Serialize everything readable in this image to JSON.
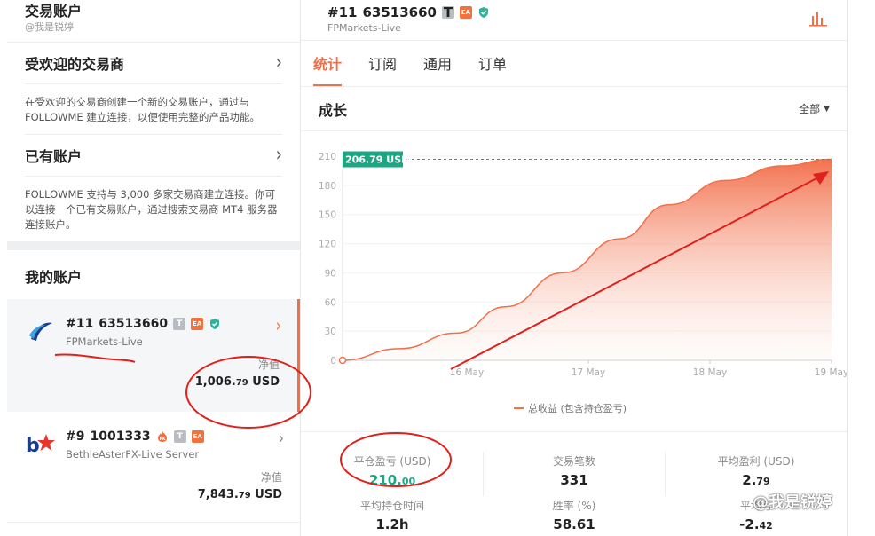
{
  "left": {
    "title": "交易账户",
    "subtitle": "@我是锐婷",
    "popular": {
      "title": "受欢迎的交易商",
      "desc": "在受欢迎的交易商创建一个新的交易账户，通过与FOLLOWME 建立连接，以便使用完整的产品功能。"
    },
    "existing": {
      "title": "已有账户",
      "desc": "FOLLOWME 支持与 3,000 多家交易商建立连接。你可以连接一个已有交易账户，通过搜索交易商 MT4 服务器连接账户。"
    },
    "my_accounts_title": "我的账户",
    "accounts": [
      {
        "num": "#11",
        "id": "63513660",
        "broker": "FPMarkets-Live",
        "nv_label": "净值",
        "nv_int": "1,006.",
        "nv_dec": "79",
        "nv_cur": "USD"
      },
      {
        "num": "#9",
        "id": "1001333",
        "broker": "BethleAsterFX-Live Server",
        "nv_label": "净值",
        "nv_int": "7,843.",
        "nv_dec": "79",
        "nv_cur": "USD"
      }
    ],
    "badge_t": "T",
    "badge_ea": "EA",
    "badge_pk": "PK"
  },
  "right": {
    "num": "#11",
    "id": "63513660",
    "broker": "FPMarkets-Live",
    "tabs": [
      "统计",
      "订阅",
      "通用",
      "订单"
    ],
    "growth_title": "成长",
    "range_label": "全部",
    "stats": [
      {
        "label": "平仓盈亏 (USD)",
        "int": "210.",
        "dec": "00"
      },
      {
        "label": "交易笔数",
        "int": "331",
        "dec": ""
      },
      {
        "label": "平均盈利 (USD)",
        "int": "2.",
        "dec": "79"
      },
      {
        "label": "平均持仓时间",
        "int": "1.2h",
        "dec": ""
      },
      {
        "label": "胜率 (%)",
        "int": "58.61",
        "dec": ""
      },
      {
        "label": "平均亏",
        "int": "-2.",
        "dec": "42"
      }
    ]
  },
  "chart_data": {
    "type": "area",
    "x": [
      "16 May",
      "17 May",
      "18 May",
      "19 May"
    ],
    "series": [
      {
        "name": "总收益 (包含持仓盈亏)",
        "x": [
          0,
          0.35,
          0.7,
          1,
          1.35,
          1.7,
          2,
          2.35,
          2.7,
          3
        ],
        "values": [
          0,
          12,
          28,
          55,
          90,
          125,
          160,
          185,
          200,
          206.79
        ]
      }
    ],
    "ylim": [
      0,
      210
    ],
    "yticks": [
      0,
      30,
      60,
      90,
      120,
      150,
      180,
      210
    ],
    "last_value_label": "206.79 USD",
    "color": "#f07049"
  },
  "watermark": "@我是锐婷"
}
